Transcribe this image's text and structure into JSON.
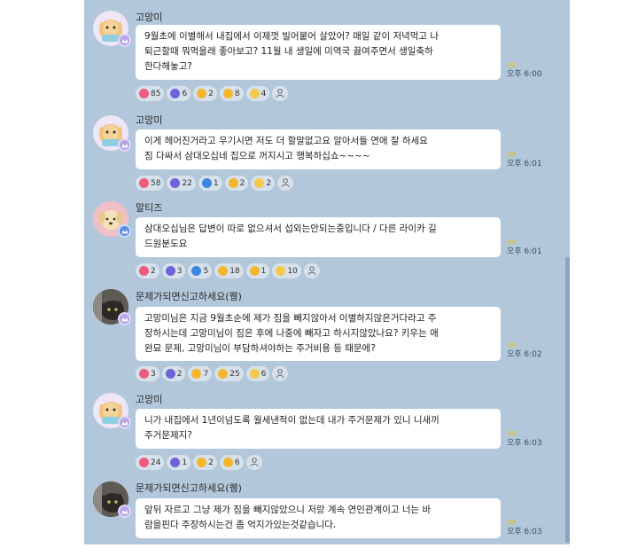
{
  "messages": [
    {
      "sender": "고망미",
      "avatar": "cat-character",
      "lines": [
        "9월초에 이별해서 내집에서 이제껏 빌어붙어 살았어? 매일 같이 저녁먹고 나",
        "퇴근할때 뭐먹을래 좋아보고? 11월 내 생일에 미역국 끓여주면서 생일축하",
        "한다해놓고?"
      ],
      "read": "99",
      "time": "오후 6:00",
      "reactions": [
        {
          "icon": "heart-icon",
          "count": "85"
        },
        {
          "icon": "thumbs-up-icon",
          "count": "6"
        },
        {
          "icon": "laugh-icon",
          "count": "2"
        },
        {
          "icon": "surprised-icon",
          "count": "8"
        },
        {
          "icon": "sad-icon",
          "count": "4"
        },
        {
          "icon": "person-icon",
          "count": ""
        }
      ]
    },
    {
      "sender": "고망미",
      "avatar": "cat-character",
      "lines": [
        "이게 헤어진거라고 우기시면 저도 더 할말없고요 알아서들 연애 잘 하세요",
        "짐 다싸서 삼대오십네 집으로 꺼지시고 행복하십쇼~~~~"
      ],
      "read": "99",
      "time": "오후 6:01",
      "reactions": [
        {
          "icon": "heart-icon",
          "count": "58"
        },
        {
          "icon": "thumbs-up-icon",
          "count": "22"
        },
        {
          "icon": "check-icon",
          "count": "1"
        },
        {
          "icon": "surprised-icon",
          "count": "2"
        },
        {
          "icon": "sad-icon",
          "count": "2"
        },
        {
          "icon": "person-icon",
          "count": ""
        }
      ]
    },
    {
      "sender": "말티즈",
      "avatar": "dog-character",
      "lines": [
        "삼대오십님은 답변이 따로 없으셔서 섭외는안되는중입니다 / 다른 라이카 길",
        "드원분도요"
      ],
      "read": "99",
      "time": "오후 6:01",
      "reactions": [
        {
          "icon": "heart-icon",
          "count": "2"
        },
        {
          "icon": "thumbs-up-icon",
          "count": "3"
        },
        {
          "icon": "check-icon",
          "count": "5"
        },
        {
          "icon": "laugh-icon",
          "count": "18"
        },
        {
          "icon": "surprised-icon",
          "count": "1"
        },
        {
          "icon": "sad-icon",
          "count": "10"
        },
        {
          "icon": "person-icon",
          "count": ""
        }
      ]
    },
    {
      "sender": "문제가되면신고하세요(퀭)",
      "avatar": "cat-photo",
      "lines": [
        "고망미님은 지금 9월초순에 제가 짐을 빼지않아서 이별하지않은거다라고 주",
        "장하시는데 고망미님이 짐은 후에 나중에 빼자고 하시지않았나요? 키우는 애",
        "완묘 문제, 고망미님이 부담하셔야하는 주거비용 등 때문에?"
      ],
      "read": "99",
      "time": "오후 6:02",
      "reactions": [
        {
          "icon": "heart-icon",
          "count": "3"
        },
        {
          "icon": "thumbs-up-icon",
          "count": "2"
        },
        {
          "icon": "laugh-icon",
          "count": "7"
        },
        {
          "icon": "surprised-icon",
          "count": "25"
        },
        {
          "icon": "sad-icon",
          "count": "6"
        },
        {
          "icon": "person-icon",
          "count": ""
        }
      ]
    },
    {
      "sender": "고망미",
      "avatar": "cat-character",
      "lines": [
        "니가 내집에서 1년이넘도록 월세낸적이 없는데 내가 주거문제가 있니 니새끼",
        "주거문제지?"
      ],
      "read": "99",
      "time": "오후 6:03",
      "reactions": [
        {
          "icon": "heart-icon",
          "count": "24"
        },
        {
          "icon": "thumbs-up-icon",
          "count": "1"
        },
        {
          "icon": "laugh-icon",
          "count": "2"
        },
        {
          "icon": "surprised-icon",
          "count": "6"
        },
        {
          "icon": "person-icon",
          "count": ""
        }
      ]
    },
    {
      "sender": "문제가되면신고하세요(퀭)",
      "avatar": "cat-photo",
      "lines": [
        "앞뒤 자르고 그냥 제가 짐을 빼지않았으니 저랑 계속 연인관계이고 너는 바",
        "람을핀다 주장하시는건 좀 억지가있는것같습니다."
      ],
      "read": "99",
      "time": "오후 6:03",
      "reactions": []
    }
  ],
  "colors": {
    "chat_bg": "#b2c7da",
    "bubble": "#ffffff",
    "reaction_bg": "#d6e1eb",
    "read_count": "#d8c23a"
  }
}
